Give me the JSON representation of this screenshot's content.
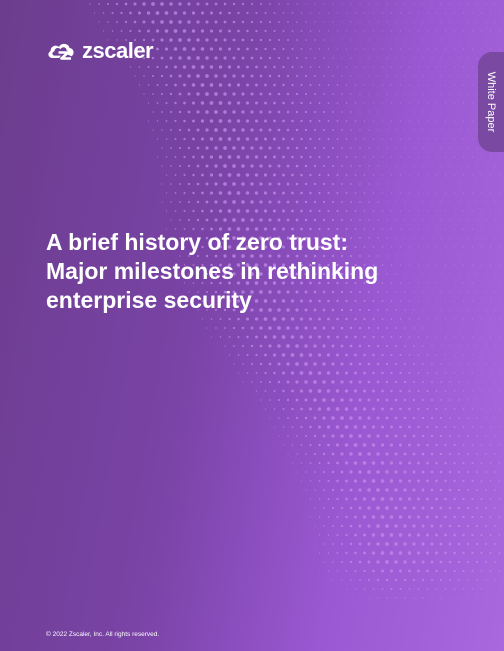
{
  "brand": {
    "name": "zscaler",
    "logo_icon": "zscaler-cloud-icon",
    "trademark": "®"
  },
  "side_tab": {
    "label": "White Paper"
  },
  "title": {
    "lines": [
      "A brief history of zero trust:",
      "Major milestones in rethinking",
      "enterprise security"
    ]
  },
  "footer": {
    "copyright": "© 2022 Zscaler, Inc. All rights reserved."
  },
  "colors": {
    "background_dark": "#6b3d8e",
    "background_light": "#a968de",
    "dot": "#c08be8",
    "tab": "#7a4aa2",
    "text": "#ffffff"
  }
}
